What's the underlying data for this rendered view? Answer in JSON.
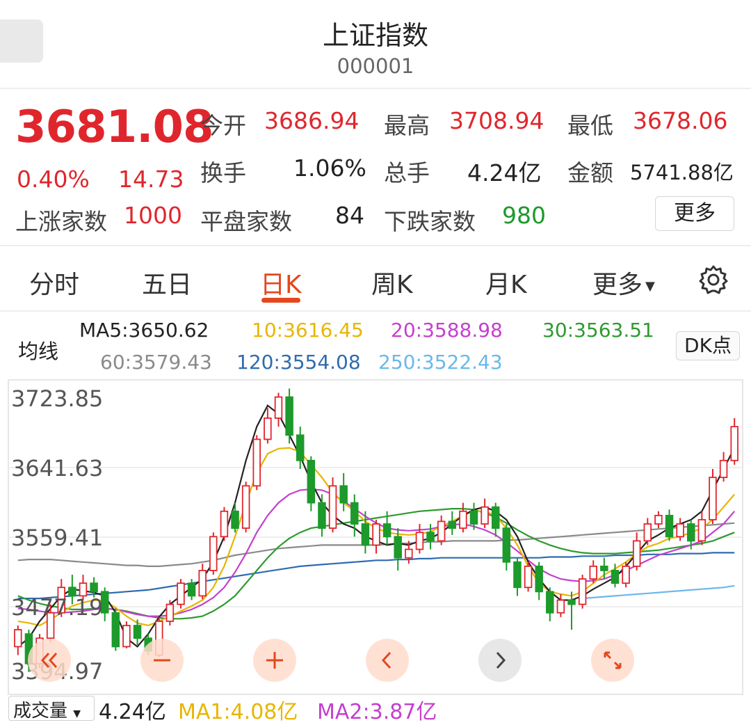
{
  "header": {
    "title": "上证指数",
    "code": "000001"
  },
  "quote": {
    "price": "3681.08",
    "change_pct": "0.40%",
    "change_abs": "14.73",
    "open_label": "今开",
    "open": "3686.94",
    "high_label": "最高",
    "high": "3708.94",
    "low_label": "最低",
    "low": "3678.06",
    "turnover_label": "换手",
    "turnover": "1.06%",
    "volume_label": "总手",
    "volume": "4.24亿",
    "amount_label": "金额",
    "amount": "5741.88亿",
    "up_label": "上涨家数",
    "up": "1000",
    "flat_label": "平盘家数",
    "flat": "84",
    "down_label": "下跌家数",
    "down": "980",
    "more_label": "更多"
  },
  "tabs": [
    {
      "label": "分时"
    },
    {
      "label": "五日"
    },
    {
      "label": "日K",
      "active": true
    },
    {
      "label": "周K"
    },
    {
      "label": "月K"
    },
    {
      "label": "更多"
    }
  ],
  "ma_legend": {
    "title": "均线",
    "ma5": "MA5:3650.62",
    "ma10": "10:3616.45",
    "ma20": "20:3588.98",
    "ma30": "30:3563.51",
    "ma60": "60:3579.43",
    "ma120": "120:3554.08",
    "ma250": "250:3522.43",
    "dk_label": "DK点"
  },
  "colors": {
    "up": "#e0262d",
    "down": "#1c9a2b",
    "ma5": "#222222",
    "ma10": "#e8b500",
    "ma20": "#c53fcf",
    "ma30": "#2e9a2e",
    "ma60": "#8a8a8a",
    "ma120": "#2f6bb0",
    "ma250": "#6bb8e8",
    "accent": "#e4471d"
  },
  "chart_data": {
    "type": "candlestick",
    "y_ticks": [
      "3723.85",
      "3641.63",
      "3559.41",
      "3477.19",
      "3394.97"
    ],
    "ylim": [
      3394.97,
      3723.85
    ],
    "series": [
      {
        "name": "MA5",
        "values": [
          3430,
          3440,
          3460,
          3475,
          3490,
          3498,
          3496,
          3494,
          3490,
          3470,
          3440,
          3430,
          3445,
          3465,
          3480,
          3490,
          3500,
          3510,
          3530,
          3560,
          3600,
          3650,
          3690,
          3715,
          3705,
          3680,
          3655,
          3625,
          3600,
          3585,
          3575,
          3570,
          3560,
          3555,
          3550,
          3552,
          3550,
          3555,
          3558,
          3565,
          3575,
          3585,
          3592,
          3595,
          3590,
          3580,
          3560,
          3530,
          3510,
          3495,
          3485,
          3485,
          3490,
          3498,
          3505,
          3512,
          3525,
          3540,
          3555,
          3562,
          3570,
          3575,
          3580,
          3590,
          3615,
          3640,
          3665
        ]
      },
      {
        "name": "MA10",
        "values": [
          3460,
          3458,
          3455,
          3462,
          3470,
          3478,
          3482,
          3485,
          3484,
          3476,
          3466,
          3458,
          3455,
          3460,
          3466,
          3472,
          3478,
          3485,
          3500,
          3525,
          3560,
          3600,
          3635,
          3658,
          3664,
          3665,
          3660,
          3645,
          3630,
          3612,
          3600,
          3590,
          3578,
          3570,
          3565,
          3563,
          3562,
          3563,
          3566,
          3572,
          3578,
          3585,
          3590,
          3590,
          3585,
          3570,
          3550,
          3525,
          3505,
          3495,
          3492,
          3490,
          3495,
          3505,
          3515,
          3522,
          3530,
          3540,
          3548,
          3552,
          3558,
          3560,
          3565,
          3570,
          3580,
          3595,
          3610
        ]
      },
      {
        "name": "MA20",
        "values": [
          3475,
          3474,
          3472,
          3470,
          3470,
          3471,
          3472,
          3474,
          3475,
          3474,
          3471,
          3468,
          3466,
          3466,
          3467,
          3470,
          3474,
          3480,
          3488,
          3500,
          3518,
          3540,
          3565,
          3585,
          3600,
          3610,
          3615,
          3616,
          3615,
          3610,
          3602,
          3593,
          3584,
          3576,
          3570,
          3568,
          3567,
          3568,
          3569,
          3572,
          3574,
          3575,
          3572,
          3568,
          3562,
          3553,
          3543,
          3532,
          3522,
          3515,
          3510,
          3508,
          3507,
          3508,
          3510,
          3515,
          3520,
          3526,
          3532,
          3538,
          3542,
          3546,
          3550,
          3555,
          3565,
          3575,
          3590
        ]
      },
      {
        "name": "MA30",
        "values": [
          3490,
          3485,
          3481,
          3478,
          3476,
          3474,
          3474,
          3475,
          3475,
          3474,
          3472,
          3469,
          3466,
          3464,
          3463,
          3463,
          3464,
          3466,
          3472,
          3480,
          3490,
          3505,
          3520,
          3535,
          3548,
          3558,
          3565,
          3570,
          3572,
          3574,
          3576,
          3578,
          3580,
          3582,
          3584,
          3586,
          3588,
          3590,
          3591,
          3592,
          3593,
          3593,
          3592,
          3588,
          3583,
          3576,
          3568,
          3561,
          3555,
          3550,
          3546,
          3543,
          3541,
          3540,
          3540,
          3540,
          3541,
          3542,
          3543,
          3544,
          3546,
          3548,
          3550,
          3552,
          3555,
          3560,
          3565
        ]
      },
      {
        "name": "MA60",
        "values": [
          3532,
          3533,
          3533,
          3533,
          3532,
          3531,
          3530,
          3529,
          3528,
          3527,
          3526,
          3526,
          3525,
          3525,
          3526,
          3527,
          3528,
          3530,
          3532,
          3535,
          3538,
          3540,
          3542,
          3544,
          3546,
          3547,
          3548,
          3549,
          3550,
          3550,
          3550,
          3550,
          3550,
          3550,
          3551,
          3552,
          3552,
          3553,
          3554,
          3554,
          3555,
          3555,
          3555,
          3555,
          3555,
          3556,
          3556,
          3557,
          3558,
          3559,
          3560,
          3561,
          3562,
          3563,
          3564,
          3565,
          3566,
          3567,
          3568,
          3569,
          3570,
          3571,
          3572,
          3573,
          3574,
          3575,
          3576
        ]
      },
      {
        "name": "MA120",
        "values": [
          3487,
          3487,
          3487,
          3488,
          3489,
          3490,
          3491,
          3492,
          3493,
          3494,
          3495,
          3496,
          3497,
          3499,
          3501,
          3503,
          3505,
          3507,
          3509,
          3511,
          3513,
          3515,
          3517,
          3519,
          3521,
          3523,
          3525,
          3526,
          3527,
          3528,
          3529,
          3530,
          3531,
          3532,
          3532,
          3533,
          3533,
          3534,
          3534,
          3535,
          3535,
          3535,
          3535,
          3535,
          3535,
          3535,
          3535,
          3535,
          3535,
          3536,
          3536,
          3536,
          3537,
          3537,
          3537,
          3538,
          3538,
          3538,
          3539,
          3539,
          3539,
          3540,
          3540,
          3540,
          3541,
          3541,
          3541
        ]
      },
      {
        "name": "MA250",
        "values": [
          null,
          null,
          null,
          null,
          null,
          null,
          null,
          null,
          null,
          null,
          null,
          null,
          null,
          null,
          null,
          null,
          null,
          null,
          null,
          null,
          null,
          null,
          null,
          null,
          null,
          null,
          null,
          null,
          null,
          null,
          null,
          null,
          null,
          null,
          null,
          null,
          null,
          null,
          null,
          null,
          null,
          null,
          null,
          null,
          null,
          null,
          null,
          null,
          null,
          null,
          null,
          null,
          3487,
          3488,
          3489,
          3490,
          3491,
          3492,
          3493,
          3494,
          3495,
          3496,
          3497,
          3498,
          3499,
          3500,
          3502
        ]
      }
    ],
    "candles": [
      [
        3430,
        3450,
        3455,
        3420
      ],
      [
        3445,
        3410,
        3450,
        3400
      ],
      [
        3410,
        3440,
        3445,
        3405
      ],
      [
        3440,
        3470,
        3480,
        3435
      ],
      [
        3470,
        3500,
        3510,
        3465
      ],
      [
        3500,
        3490,
        3515,
        3480
      ],
      [
        3490,
        3505,
        3515,
        3485
      ],
      [
        3505,
        3495,
        3512,
        3488
      ],
      [
        3495,
        3470,
        3500,
        3460
      ],
      [
        3470,
        3430,
        3475,
        3425
      ],
      [
        3430,
        3455,
        3460,
        3428
      ],
      [
        3455,
        3440,
        3462,
        3432
      ],
      [
        3440,
        3425,
        3445,
        3420
      ],
      [
        3420,
        3460,
        3465,
        3418
      ],
      [
        3460,
        3480,
        3485,
        3455
      ],
      [
        3480,
        3505,
        3510,
        3475
      ],
      [
        3505,
        3490,
        3510,
        3485
      ],
      [
        3490,
        3520,
        3528,
        3486
      ],
      [
        3520,
        3560,
        3565,
        3515
      ],
      [
        3560,
        3590,
        3595,
        3555
      ],
      [
        3590,
        3570,
        3600,
        3565
      ],
      [
        3570,
        3620,
        3625,
        3565
      ],
      [
        3620,
        3675,
        3680,
        3615
      ],
      [
        3675,
        3700,
        3712,
        3670
      ],
      [
        3700,
        3725,
        3730,
        3690
      ],
      [
        3725,
        3680,
        3735,
        3670
      ],
      [
        3680,
        3650,
        3690,
        3640
      ],
      [
        3650,
        3600,
        3655,
        3590
      ],
      [
        3600,
        3570,
        3610,
        3560
      ],
      [
        3570,
        3620,
        3630,
        3565
      ],
      [
        3620,
        3600,
        3635,
        3590
      ],
      [
        3600,
        3575,
        3610,
        3560
      ],
      [
        3575,
        3550,
        3590,
        3540
      ],
      [
        3550,
        3575,
        3580,
        3540
      ],
      [
        3575,
        3560,
        3590,
        3550
      ],
      [
        3560,
        3535,
        3570,
        3520
      ],
      [
        3535,
        3545,
        3555,
        3528
      ],
      [
        3545,
        3565,
        3575,
        3540
      ],
      [
        3565,
        3555,
        3575,
        3545
      ],
      [
        3555,
        3578,
        3585,
        3550
      ],
      [
        3578,
        3570,
        3590,
        3562
      ],
      [
        3570,
        3590,
        3600,
        3565
      ],
      [
        3590,
        3575,
        3600,
        3568
      ],
      [
        3575,
        3595,
        3605,
        3570
      ],
      [
        3595,
        3570,
        3600,
        3560
      ],
      [
        3570,
        3530,
        3575,
        3520
      ],
      [
        3530,
        3500,
        3535,
        3490
      ],
      [
        3500,
        3525,
        3530,
        3495
      ],
      [
        3525,
        3495,
        3530,
        3485
      ],
      [
        3495,
        3470,
        3500,
        3460
      ],
      [
        3470,
        3485,
        3492,
        3465
      ],
      [
        3485,
        3480,
        3495,
        3450
      ],
      [
        3480,
        3510,
        3515,
        3475
      ],
      [
        3510,
        3525,
        3532,
        3505
      ],
      [
        3525,
        3520,
        3535,
        3510
      ],
      [
        3520,
        3505,
        3528,
        3500
      ],
      [
        3505,
        3525,
        3530,
        3500
      ],
      [
        3525,
        3555,
        3565,
        3520
      ],
      [
        3555,
        3575,
        3582,
        3550
      ],
      [
        3575,
        3585,
        3590,
        3570
      ],
      [
        3585,
        3560,
        3592,
        3555
      ],
      [
        3560,
        3575,
        3582,
        3555
      ],
      [
        3575,
        3555,
        3580,
        3545
      ],
      [
        3555,
        3580,
        3590,
        3550
      ],
      [
        3580,
        3630,
        3640,
        3575
      ],
      [
        3630,
        3650,
        3660,
        3625
      ],
      [
        3650,
        3690,
        3700,
        3645
      ]
    ]
  }
}
